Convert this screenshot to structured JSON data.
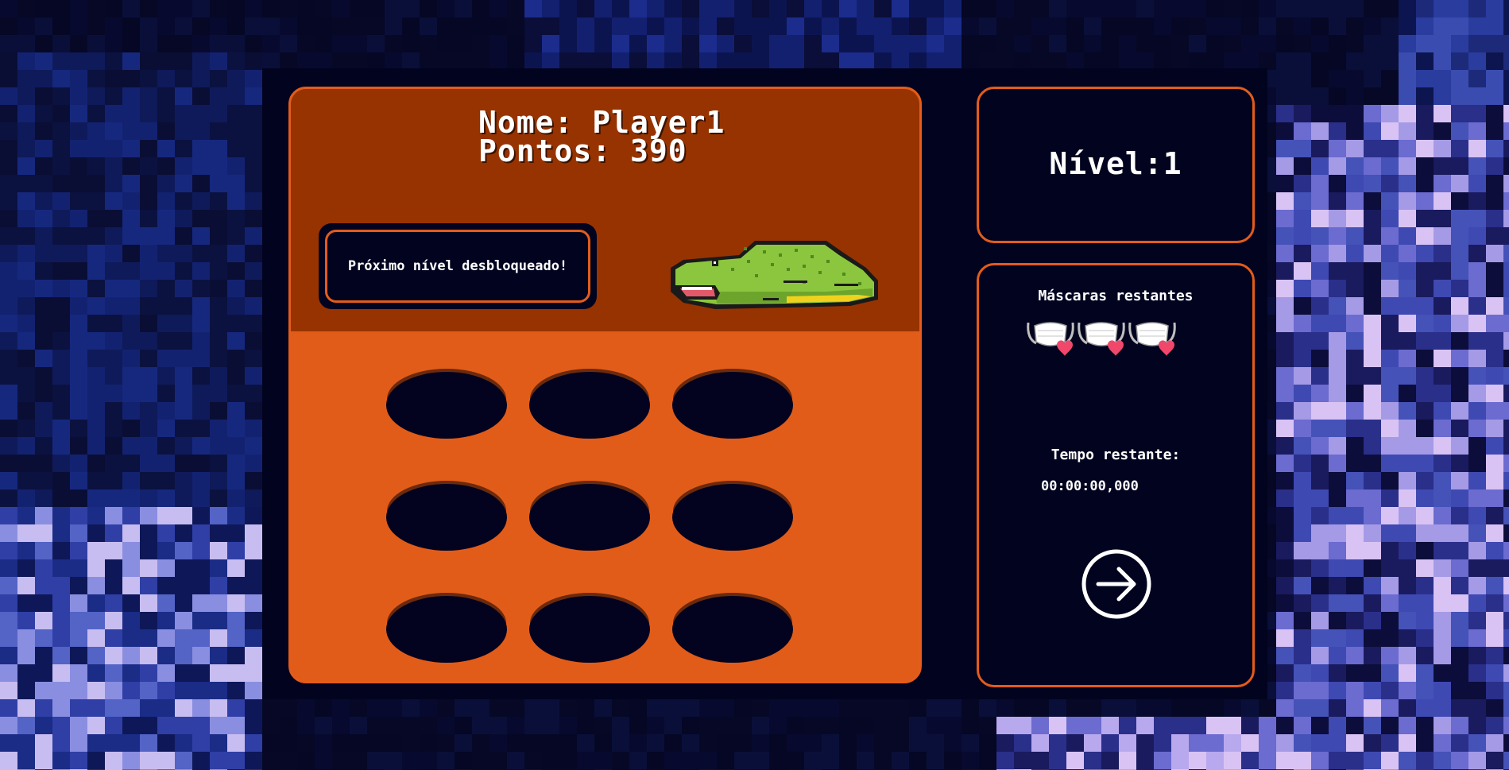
{
  "player": {
    "name_line": "Nome: Player1",
    "points_line": "Pontos: 390"
  },
  "message": "Próximo nível desbloqueado!",
  "level": {
    "text": "Nível:1"
  },
  "masks": {
    "label": "Máscaras restantes",
    "count": 3,
    "icon": "mask-heart-icon"
  },
  "timer": {
    "label": "Tempo restante:",
    "value": "00:00:00,000"
  },
  "next_button": {
    "icon": "arrow-right-circle-icon"
  },
  "holes": {
    "rows": 3,
    "cols": 3
  },
  "colors": {
    "accent": "#e35c1b",
    "board": "#e25c19",
    "header": "#973301",
    "dark": "#02031f",
    "croc_green": "#8cc63e",
    "heart": "#f0476b"
  }
}
